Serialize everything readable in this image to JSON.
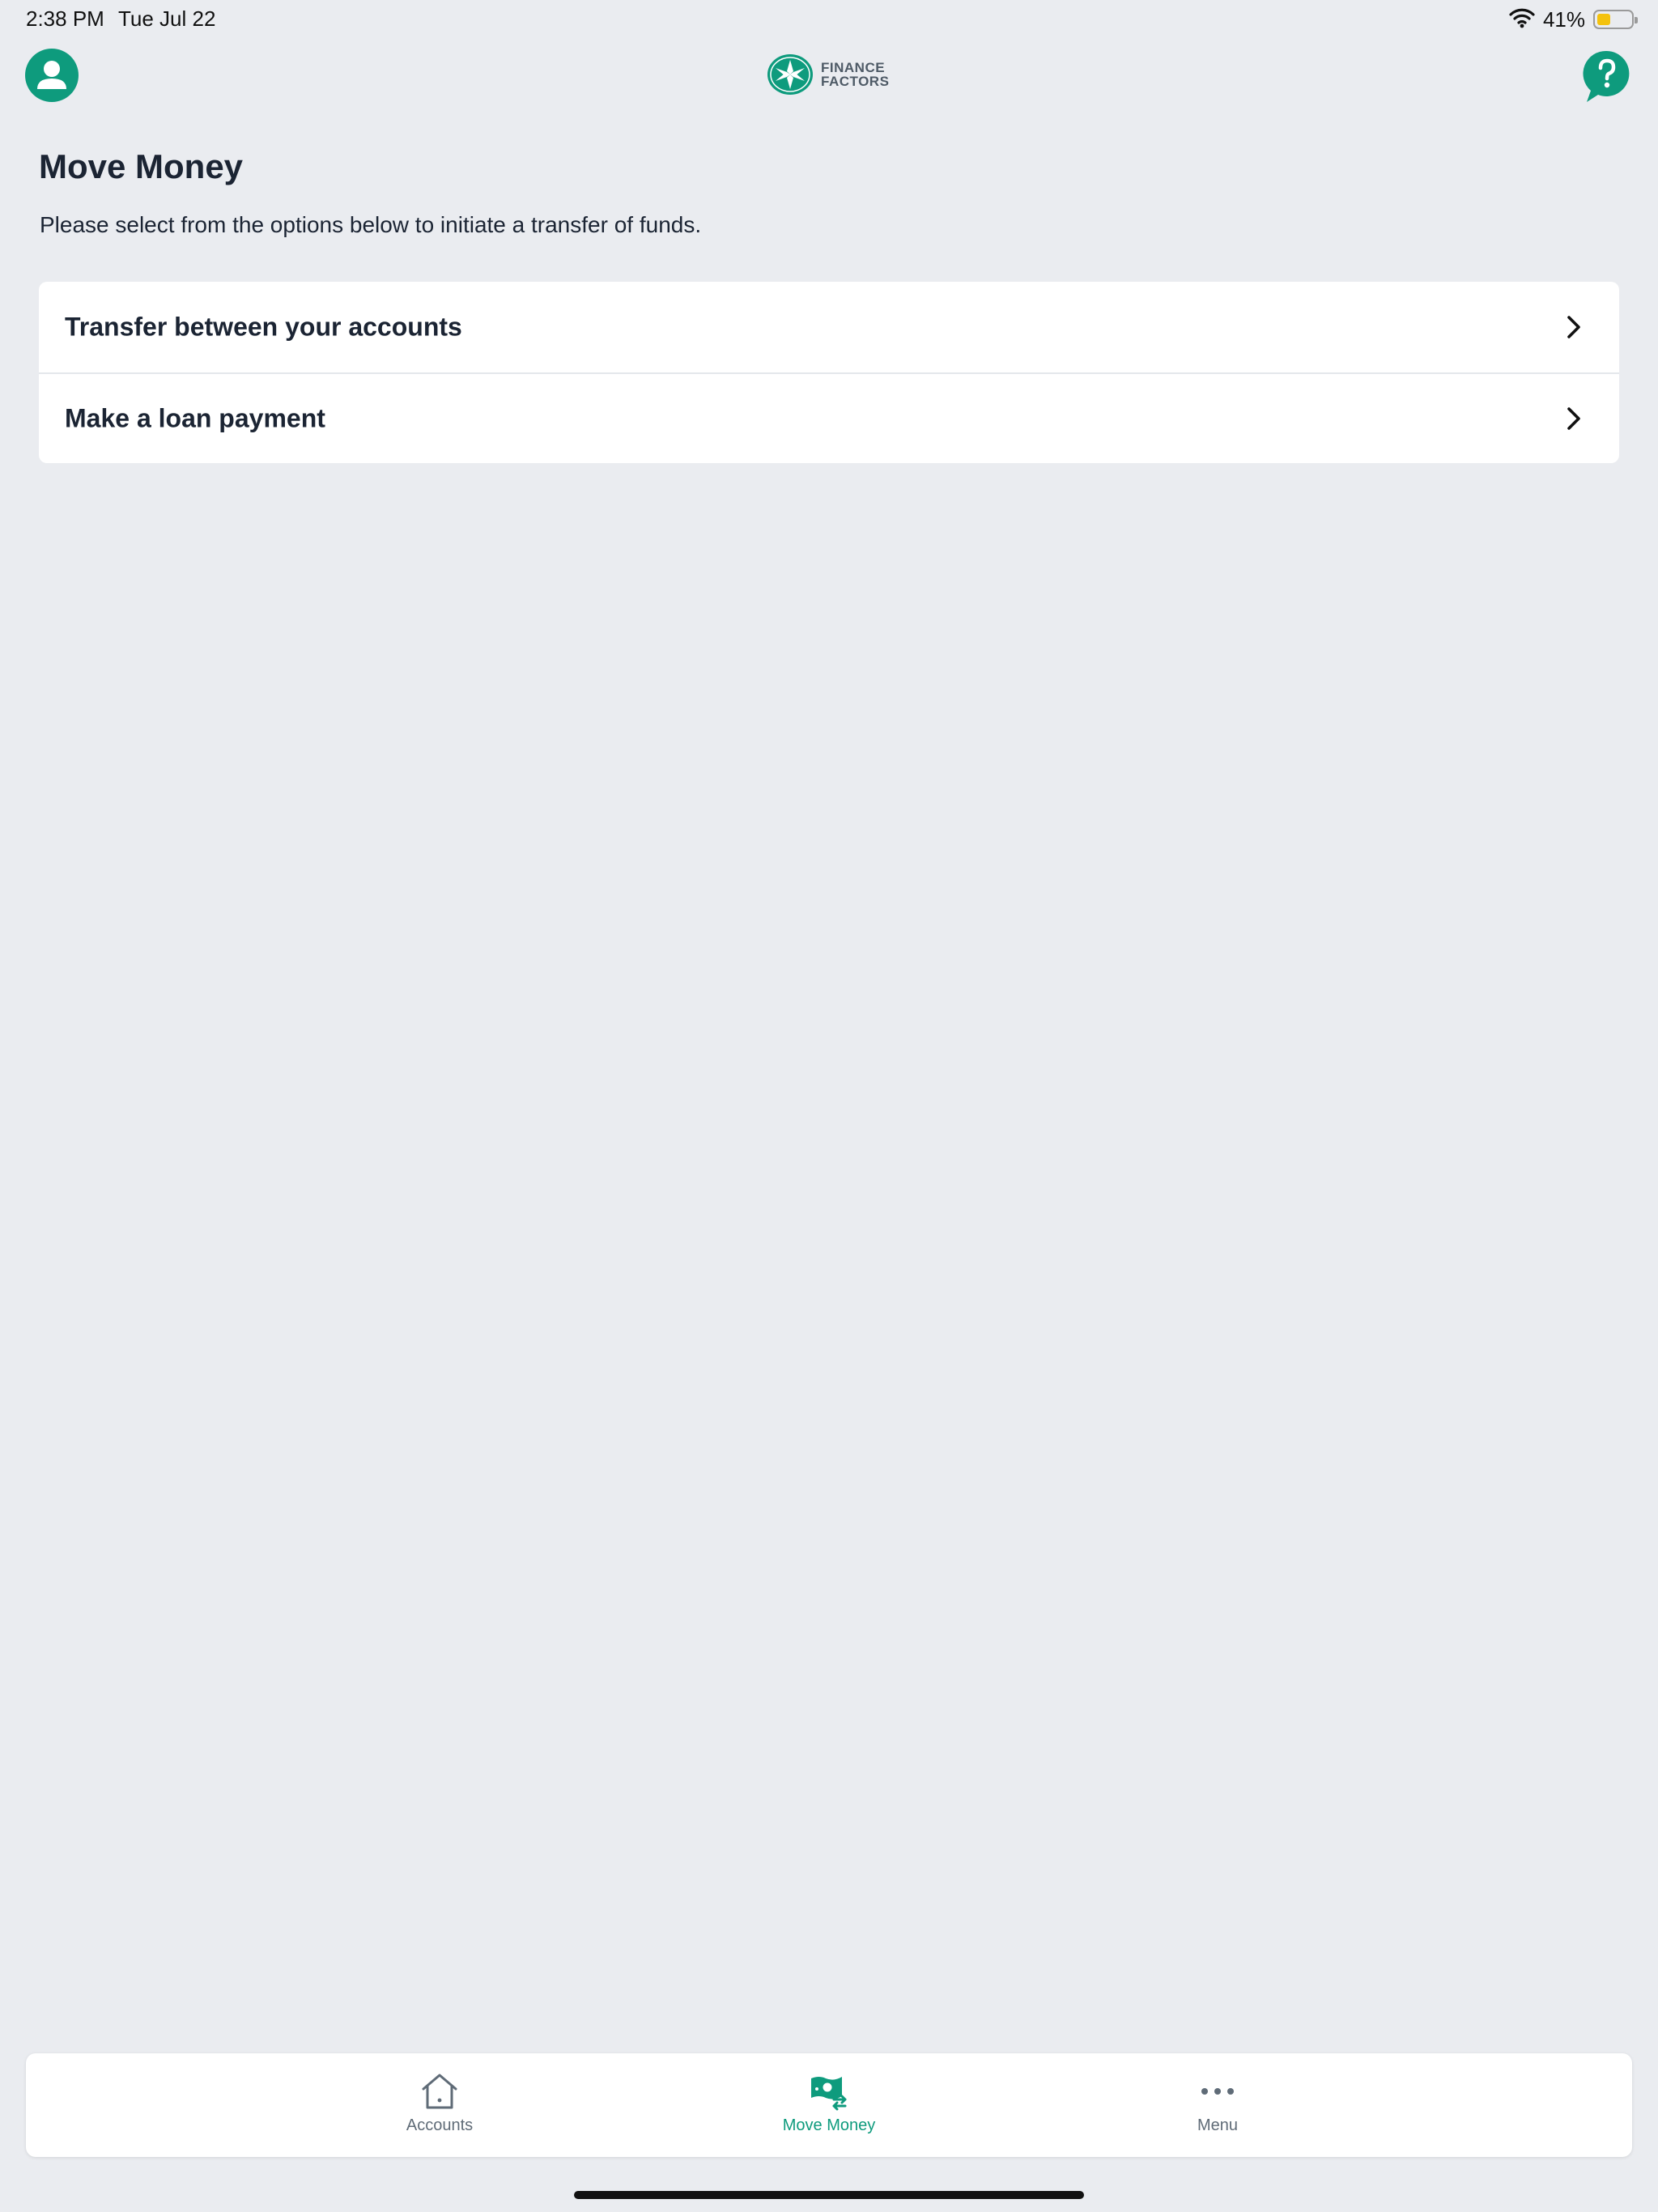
{
  "status_bar": {
    "time": "2:38 PM",
    "date": "Tue Jul 22",
    "battery_percent_label": "41%",
    "battery_level": 0.41,
    "wifi_icon": "wifi-icon"
  },
  "header": {
    "profile_icon": "user-icon",
    "logo": {
      "line1": "FINANCE",
      "line2": "FACTORS"
    },
    "help_icon": "help-chat-icon"
  },
  "main": {
    "title": "Move Money",
    "subtitle": "Please select from the options below to initiate a transfer of funds.",
    "options": [
      {
        "label": "Transfer between your accounts",
        "icon": "chevron-right-icon"
      },
      {
        "label": "Make a loan payment",
        "icon": "chevron-right-icon"
      }
    ]
  },
  "tab_bar": {
    "tabs": [
      {
        "label": "Accounts",
        "icon": "home-icon",
        "active": false
      },
      {
        "label": "Move Money",
        "icon": "money-transfer-icon",
        "active": true
      },
      {
        "label": "Menu",
        "icon": "more-dots-icon",
        "active": false
      }
    ]
  },
  "colors": {
    "brand": "#0E9B7D",
    "background": "#EAECF0",
    "text": "#1B2433",
    "inactive_tab": "#5F6B77",
    "battery": "#F4C20D"
  }
}
